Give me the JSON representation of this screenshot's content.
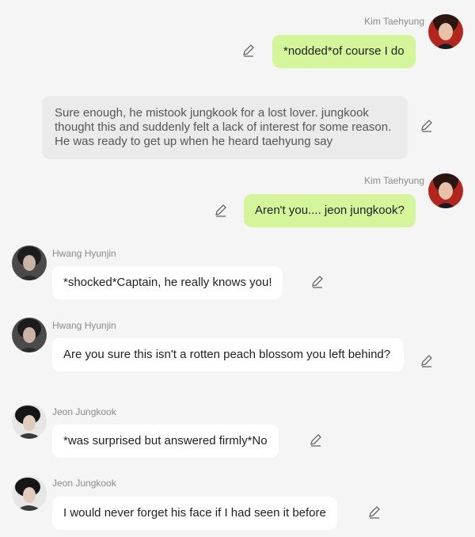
{
  "messages": [
    {
      "type": "self",
      "name": "Kim Taehyung",
      "avatar_icon": "kim-taehyung-avatar",
      "text": "*nodded*of course I do"
    },
    {
      "type": "narration",
      "text": "Sure enough, he mistook jungkook for a lost lover. jungkook thought this and suddenly felt a lack of interest for some reason. He was ready to get up when he heard taehyung say"
    },
    {
      "type": "self",
      "name": "Kim Taehyung",
      "avatar_icon": "kim-taehyung-avatar",
      "text": "Aren't you.... jeon jungkook?"
    },
    {
      "type": "other",
      "name": "Hwang Hyunjin",
      "avatar_icon": "hwang-hyunjin-avatar",
      "text": "*shocked*Captain, he really knows you!"
    },
    {
      "type": "other",
      "name": "Hwang Hyunjin",
      "avatar_icon": "hwang-hyunjin-avatar",
      "text": "Are you sure this isn't a rotten peach blossom you left behind?"
    },
    {
      "type": "other",
      "name": "Jeon Jungkook",
      "avatar_icon": "jeon-jungkook-avatar",
      "text": "*was surprised but answered firmly*No"
    },
    {
      "type": "other",
      "name": "Jeon Jungkook",
      "avatar_icon": "jeon-jungkook-avatar",
      "text": "I would never forget his face if I had seen it before"
    }
  ],
  "colors": {
    "self_bubble": "#d4f59a",
    "other_bubble": "#ffffff",
    "narration_bubble": "#ebebeb",
    "background": "#f5f5f5"
  },
  "icons": {
    "edit": "pencil-edit-icon"
  }
}
